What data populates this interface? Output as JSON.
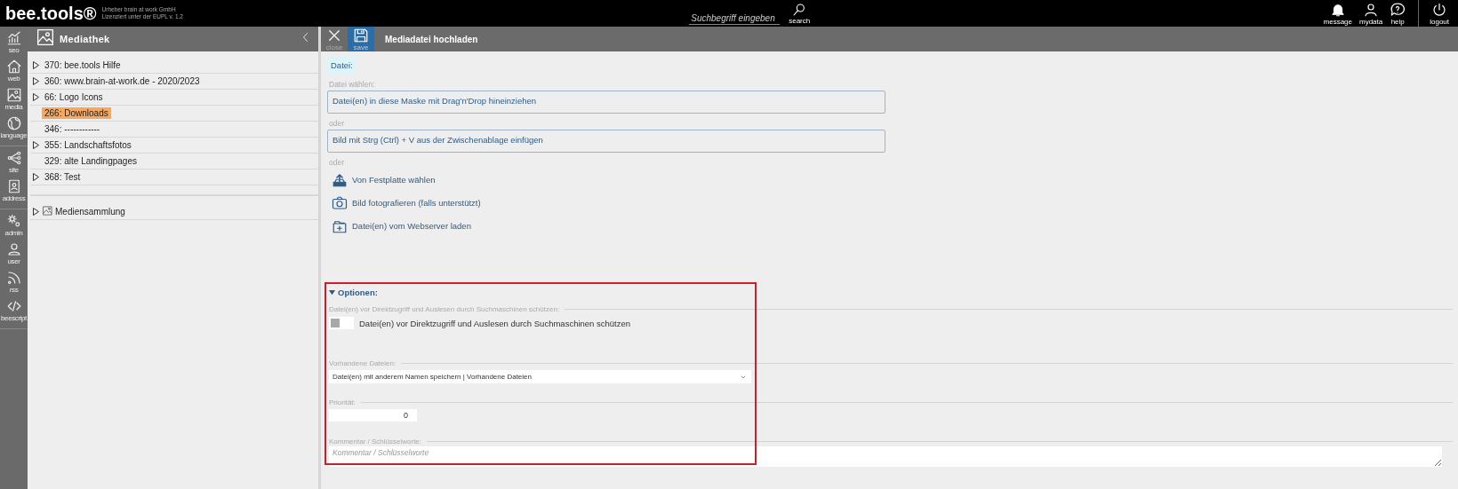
{
  "header": {
    "logo": "bee.tools®",
    "credits": [
      "Urheber brain at work GmbH",
      "Lizenziert unter der EUPL v. 1.2"
    ],
    "search": {
      "placeholder": "Suchbegriff eingeben",
      "button": "search"
    },
    "actions": [
      {
        "kind": "message",
        "label": "message"
      },
      {
        "kind": "mydata",
        "label": "mydata"
      },
      {
        "kind": "help",
        "label": "help"
      },
      {
        "kind": "logout",
        "label": "logout"
      }
    ]
  },
  "rail": {
    "groups": [
      [
        {
          "kind": "seo",
          "label": "seo"
        },
        {
          "kind": "web",
          "label": "web"
        },
        {
          "kind": "media",
          "label": "media"
        },
        {
          "kind": "language",
          "label": "language"
        }
      ],
      [
        {
          "kind": "site",
          "label": "site"
        },
        {
          "kind": "address",
          "label": "address"
        }
      ],
      [
        {
          "kind": "admin",
          "label": "admin"
        },
        {
          "kind": "user",
          "label": "user"
        },
        {
          "kind": "rss",
          "label": "rss"
        },
        {
          "kind": "beescript",
          "label": "beescript"
        }
      ]
    ]
  },
  "library": {
    "title": "Mediathek",
    "tree": [
      {
        "label": "370: bee.tools Hilfe",
        "expandable": true,
        "selected": false
      },
      {
        "label": "360: www.brain-at-work.de - 2020/2023",
        "expandable": true,
        "selected": false
      },
      {
        "label": "66: Logo Icons",
        "expandable": true,
        "selected": false
      },
      {
        "label": "266: Downloads",
        "expandable": false,
        "selected": true
      },
      {
        "label": "346: ------------",
        "expandable": false,
        "selected": false
      },
      {
        "label": "355: Landschaftsfotos",
        "expandable": true,
        "selected": false
      },
      {
        "label": "329: alte Landingpages",
        "expandable": false,
        "selected": false
      },
      {
        "label": "368: Test",
        "expandable": true,
        "selected": false
      }
    ],
    "collection": {
      "label": "Mediensammlung",
      "expandable": true
    }
  },
  "upload": {
    "toolbar": [
      {
        "kind": "close",
        "label": "close",
        "active": false
      },
      {
        "kind": "save",
        "label": "save",
        "active": true
      }
    ],
    "title": "Mediadatei hochladen",
    "tab": "Datei:",
    "choose_label": "Datei wählen:",
    "drop_zone": "Datei(en) in diese Maske mit Drag'n'Drop hineinziehen",
    "separator_1": "oder",
    "paste_zone": "Bild mit Strg (Ctrl) + V aus der Zwischenablage einfügen",
    "separator_2": "oder",
    "actions": [
      {
        "kind": "upload",
        "label": "Von Festplatte wählen"
      },
      {
        "kind": "camera",
        "label": "Bild fotografieren (falls unterstützt)"
      },
      {
        "kind": "server",
        "label": "Datei(en) vom Webserver laden"
      }
    ],
    "options": {
      "title": "Optionen:",
      "expanded": true,
      "protect": {
        "legend": "Datei(en) vor Direktzugriff und Auslesen durch Suchmaschinen schützen:",
        "label": "Datei(en) vor Direktzugriff und Auslesen durch Suchmaschinen schützen",
        "checked": false
      },
      "existing": {
        "legend": "Vorhandene Dateien:",
        "value": "Datei(en) mit anderem Namen speichern | Vorhandene Dateien"
      },
      "priority": {
        "legend": "Priorität:",
        "value": "0"
      },
      "comment": {
        "legend": "Kommentar / Schlüsselworte:",
        "placeholder": "Kommentar / Schlüsselworte"
      }
    }
  }
}
